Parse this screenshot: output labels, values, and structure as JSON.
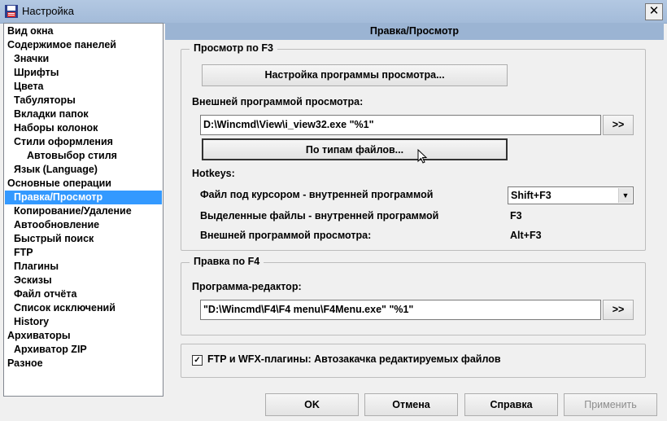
{
  "window": {
    "title": "Настройка",
    "close": "✕"
  },
  "sidebar": {
    "selected": 11,
    "items": [
      {
        "label": "Вид окна",
        "indent": 0
      },
      {
        "label": "Содержимое панелей",
        "indent": 0
      },
      {
        "label": "Значки",
        "indent": 1
      },
      {
        "label": "Шрифты",
        "indent": 1
      },
      {
        "label": "Цвета",
        "indent": 1
      },
      {
        "label": "Табуляторы",
        "indent": 1
      },
      {
        "label": "Вкладки папок",
        "indent": 1
      },
      {
        "label": "Наборы колонок",
        "indent": 1
      },
      {
        "label": "Стили оформления",
        "indent": 1
      },
      {
        "label": "Автовыбор стиля",
        "indent": 2
      },
      {
        "label": "Язык (Language)",
        "indent": 1
      },
      {
        "label": "Основные операции",
        "indent": 0
      },
      {
        "label": "Правка/Просмотр",
        "indent": 1
      },
      {
        "label": "Копирование/Удаление",
        "indent": 1
      },
      {
        "label": "Автообновление",
        "indent": 1
      },
      {
        "label": "Быстрый поиск",
        "indent": 1
      },
      {
        "label": "FTP",
        "indent": 1
      },
      {
        "label": "Плагины",
        "indent": 1
      },
      {
        "label": "Эскизы",
        "indent": 1
      },
      {
        "label": "Файл отчёта",
        "indent": 1
      },
      {
        "label": "Список исключений",
        "indent": 1
      },
      {
        "label": "History",
        "indent": 1
      },
      {
        "label": "Архиваторы",
        "indent": 0
      },
      {
        "label": "Архиватор ZIP",
        "indent": 1
      },
      {
        "label": "Разное",
        "indent": 0
      }
    ]
  },
  "main": {
    "header": "Правка/Просмотр",
    "f3": {
      "title": "Просмотр по F3",
      "config_button": "Настройка программы просмотра...",
      "external_label": "Внешней программой просмотра:",
      "external_value": "D:\\Wincmd\\View\\i_view32.exe \"%1\"",
      "browse": ">>",
      "by_type_button": "По типам файлов...",
      "hotkeys_label": "Hotkeys:",
      "hotkeys": [
        {
          "label": "Файл под курсором - внутренней программой",
          "value": "Shift+F3"
        },
        {
          "label": "Выделенные файлы - внутренней программой",
          "value": "F3"
        },
        {
          "label": "Внешней программой просмотра:",
          "value": "Alt+F3"
        }
      ]
    },
    "f4": {
      "title": "Правка по F4",
      "editor_label": "Программа-редактор:",
      "editor_value": "\"D:\\Wincmd\\F4\\F4 menu\\F4Menu.exe\" \"%1\"",
      "browse": ">>"
    },
    "ftp_checkbox": {
      "label": "FTP и WFX-плагины: Автозакачка редактируемых файлов",
      "checked": true
    }
  },
  "buttons": {
    "ok": "OK",
    "cancel": "Отмена",
    "help": "Справка",
    "apply": "Применить"
  },
  "colors": {
    "selection": "#3399ff",
    "header": "#9bb4d3",
    "disabled_text": "#8c8c8c"
  }
}
